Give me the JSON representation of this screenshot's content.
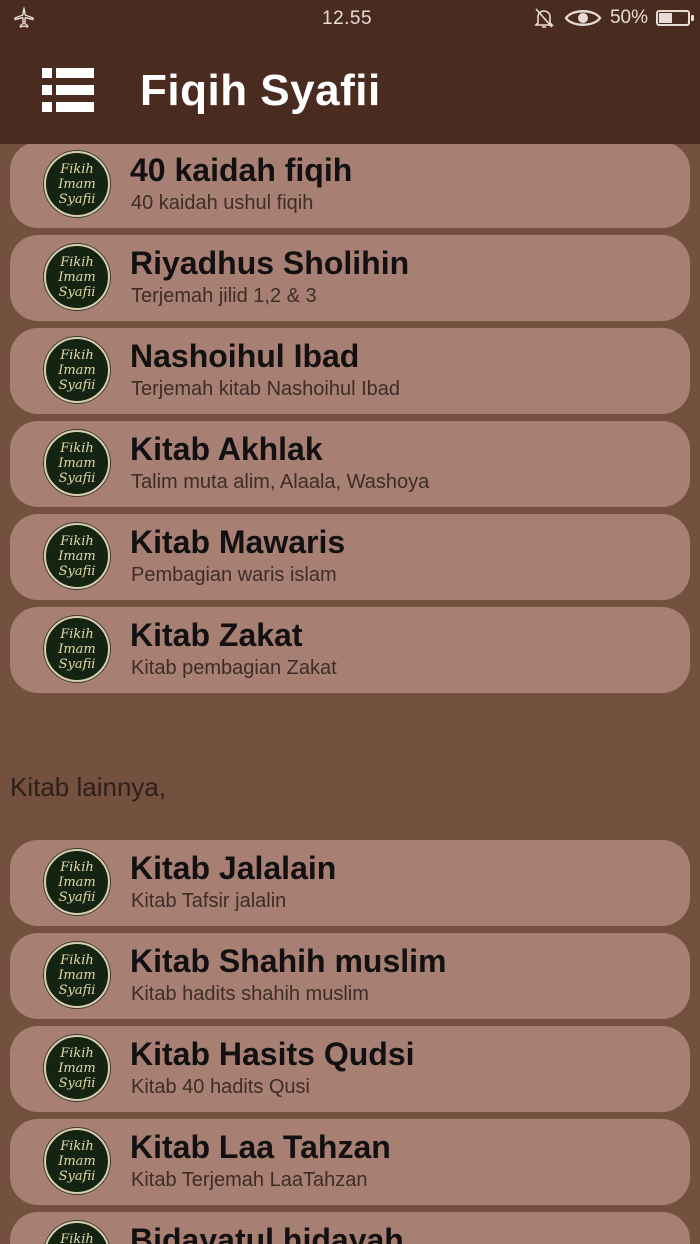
{
  "status_bar": {
    "time": "12.55",
    "battery_text": "50%",
    "battery_level": 0.5,
    "icons": [
      "airplane-icon",
      "bell-off-icon",
      "eye-icon",
      "battery-icon"
    ]
  },
  "app_bar": {
    "title": "Fiqih Syafii",
    "menu_icon": "list-menu-icon"
  },
  "logo": {
    "line1": "Fikih",
    "line2": "Imam",
    "line3": "Syafii"
  },
  "list1": [
    {
      "title": "40 kaidah fiqih",
      "subtitle": "40 kaidah ushul fiqih"
    },
    {
      "title": "Riyadhus Sholihin",
      "subtitle": "Terjemah jilid 1,2 & 3"
    },
    {
      "title": "Nashoihul Ibad",
      "subtitle": "Terjemah kitab Nashoihul Ibad"
    },
    {
      "title": "Kitab Akhlak",
      "subtitle": "Talim muta alim, Alaala, Washoya"
    },
    {
      "title": "Kitab Mawaris",
      "subtitle": "Pembagian waris islam"
    },
    {
      "title": "Kitab Zakat",
      "subtitle": "Kitab pembagian Zakat"
    }
  ],
  "section_label": "Kitab lainnya,",
  "list2": [
    {
      "title": "Kitab Jalalain",
      "subtitle": "Kitab Tafsir jalalin"
    },
    {
      "title": "Kitab Shahih muslim",
      "subtitle": "Kitab hadits shahih muslim"
    },
    {
      "title": "Kitab Hasits Qudsi",
      "subtitle": "Kitab 40 hadits Qusi"
    },
    {
      "title": "Kitab Laa Tahzan",
      "subtitle": "Kitab Terjemah LaaTahzan"
    },
    {
      "title": "Bidayatul hidayah",
      "subtitle": ""
    }
  ],
  "colors": {
    "background": "#74503f",
    "app_bar": "#4a2b20",
    "card": "#a87f73"
  }
}
